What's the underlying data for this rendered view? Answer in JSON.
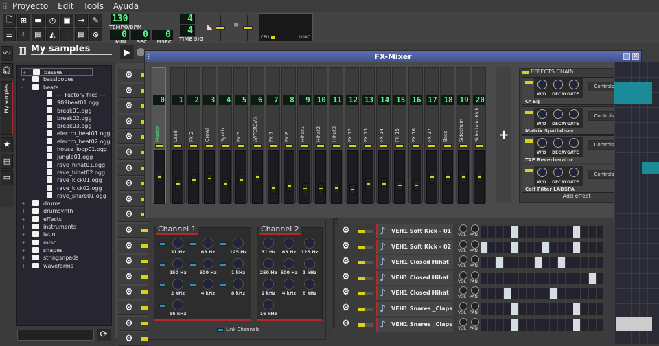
{
  "menu": [
    "Proyecto",
    "Edit",
    "Tools",
    "Ayuda"
  ],
  "toolbar": {
    "row1_icons": [
      "new-project-icon",
      "new-from-template-icon",
      "open-project-icon",
      "recent-projects-icon",
      "save-icon",
      "export-icon",
      "export-tracks-icon"
    ],
    "row2_icons": [
      "song-editor-icon",
      "beat-editor-icon",
      "piano-roll-icon",
      "automation-editor-icon",
      "fx-mixer-icon",
      "project-notes-icon",
      "controller-rack-icon"
    ],
    "tempo": "130",
    "tempo_label": "TEMPO/BPM",
    "min": "0",
    "sec": "0",
    "msec": "0",
    "min_label": "MIN",
    "sec_label": "SEC",
    "msec_label": "MSEC",
    "timesig_num": "4",
    "timesig_den": "4",
    "timesig_label": "TIME SIG",
    "cpu_label": "CPU",
    "load_label": "LOAD"
  },
  "sidebar": {
    "title": "My samples",
    "tab_label": "My samples"
  },
  "browser": {
    "items": [
      {
        "label": "basses",
        "type": "folder",
        "level": 0,
        "expander": "+"
      },
      {
        "label": "bassloopes",
        "type": "folder",
        "level": 0,
        "expander": "+"
      },
      {
        "label": "beats",
        "type": "folder",
        "level": 0,
        "expander": "-"
      },
      {
        "label": "--- Factory files ---",
        "type": "factory",
        "level": 1
      },
      {
        "label": "909beat01.ogg",
        "type": "file",
        "level": 1
      },
      {
        "label": "break01.ogg",
        "type": "file",
        "level": 1
      },
      {
        "label": "break02.ogg",
        "type": "file",
        "level": 1
      },
      {
        "label": "break03.ogg",
        "type": "file",
        "level": 1
      },
      {
        "label": "electro_beat01.ogg",
        "type": "file",
        "level": 1
      },
      {
        "label": "electro_beat02.ogg",
        "type": "file",
        "level": 1
      },
      {
        "label": "house_loop01.ogg",
        "type": "file",
        "level": 1
      },
      {
        "label": "jungle01.ogg",
        "type": "file",
        "level": 1
      },
      {
        "label": "rave_hihat01.ogg",
        "type": "file",
        "level": 1
      },
      {
        "label": "rave_hihat02.ogg",
        "type": "file",
        "level": 1
      },
      {
        "label": "rave_kick01.ogg",
        "type": "file",
        "level": 1
      },
      {
        "label": "rave_kick02.ogg",
        "type": "file",
        "level": 1
      },
      {
        "label": "rave_snare01.ogg",
        "type": "file",
        "level": 1
      },
      {
        "label": "drums",
        "type": "folder",
        "level": 0,
        "expander": "+"
      },
      {
        "label": "drumsynth",
        "type": "folder",
        "level": 0,
        "expander": "+"
      },
      {
        "label": "effects",
        "type": "folder",
        "level": 0,
        "expander": "+"
      },
      {
        "label": "instruments",
        "type": "folder",
        "level": 0,
        "expander": "+"
      },
      {
        "label": "latin",
        "type": "folder",
        "level": 0,
        "expander": "+"
      },
      {
        "label": "misc",
        "type": "folder",
        "level": 0,
        "expander": "+"
      },
      {
        "label": "shapes",
        "type": "folder",
        "level": 0,
        "expander": "+"
      },
      {
        "label": "stringsnpads",
        "type": "folder",
        "level": 0,
        "expander": "+"
      },
      {
        "label": "waveforms",
        "type": "folder",
        "level": 0,
        "expander": "+"
      }
    ],
    "filter_value": ""
  },
  "fxmixer": {
    "title": "FX-Mixer",
    "add_label": "+",
    "channels": [
      {
        "num": "0",
        "name": "Master",
        "level": 0.5
      },
      {
        "num": "1",
        "name": "Lead",
        "level": 0.34
      },
      {
        "num": "2",
        "name": "FX 2",
        "level": 0.43
      },
      {
        "num": "3",
        "name": "Growl",
        "level": 0.46
      },
      {
        "num": "4",
        "name": "Synth",
        "level": 0.34
      },
      {
        "num": "5",
        "name": "FX 5",
        "level": 0.43
      },
      {
        "num": "6",
        "name": "////PERC////",
        "level": 0.5
      },
      {
        "num": "7",
        "name": "FX 7",
        "level": 0.23
      },
      {
        "num": "8",
        "name": "FX 8",
        "level": 0.29
      },
      {
        "num": "9",
        "name": "Hihat1",
        "level": 0.21
      },
      {
        "num": "10",
        "name": "Hihat2",
        "level": 0.22
      },
      {
        "num": "11",
        "name": "Hihat3",
        "level": 0.23
      },
      {
        "num": "12",
        "name": "FX 12",
        "level": 0.2
      },
      {
        "num": "13",
        "name": "FX 13",
        "level": 0.34
      },
      {
        "num": "14",
        "name": "FX 14",
        "level": 0.33
      },
      {
        "num": "15",
        "name": "FX 15",
        "level": 0.3
      },
      {
        "num": "16",
        "name": "FX 16",
        "level": 0.3
      },
      {
        "num": "17",
        "name": "FX 17",
        "level": 0.5
      },
      {
        "num": "18",
        "name": "Bass",
        "level": 0.5
      },
      {
        "num": "19",
        "name": "Sidechain",
        "level": 0.5
      },
      {
        "num": "20",
        "name": "Sidechain Kick",
        "level": 0.5
      }
    ],
    "effects_chain": {
      "title": "EFFECTS CHAIN",
      "knob_labels": [
        "W/D",
        "DECAY",
        "GATE"
      ],
      "controls_label": "Controls",
      "effects": [
        "C* Eq",
        "Matrix Spatialiser",
        "TAP Reverberator",
        "Calf Filter LADSPA"
      ],
      "add_label": "Add effect"
    }
  },
  "eq": {
    "channels": [
      {
        "title": "Channel 1",
        "bands": [
          "31 Hz",
          "63 Hz",
          "125 Hz",
          "250 Hz",
          "500 Hz",
          "1 kHz",
          "2 kHz",
          "4 kHz",
          "8 kHz",
          "16 kHz"
        ]
      },
      {
        "title": "Channel 2",
        "bands": [
          "31 Hz",
          "63 Hz",
          "125 Hz",
          "250 Hz",
          "500 Hz",
          "1 kHz",
          "2 kHz",
          "4 kHz",
          "8 kHz",
          "16 kHz"
        ]
      }
    ],
    "link_label": "Link Channels"
  },
  "beat": {
    "vol_label": "VOL",
    "pan_label": "PAN",
    "tracks": [
      {
        "name": "VEH1 Soft Kick - 01",
        "steps": [
          4,
          12
        ]
      },
      {
        "name": "VEH1 Soft Kick - 02",
        "steps": [
          0,
          4,
          8,
          12
        ]
      },
      {
        "name": "VEH1 Closed Hihat",
        "steps": [
          2,
          7,
          10
        ]
      },
      {
        "name": "VEH1 Closed Hihat",
        "steps": [
          14
        ]
      },
      {
        "name": "VEH1 Closed Hihat",
        "steps": [
          3,
          9
        ]
      },
      {
        "name": "VEH1 Snares _Claps",
        "steps": [
          4,
          12
        ]
      },
      {
        "name": "VEH1 Snares _Claps",
        "steps": [
          4,
          12
        ]
      }
    ]
  },
  "colors": {
    "accent_led": "#d8d21a",
    "lcd": "#5bf58a",
    "title_bar": "#4a5a9a",
    "eq_led": "#2790c6",
    "eq_underline": "#b3282d"
  }
}
